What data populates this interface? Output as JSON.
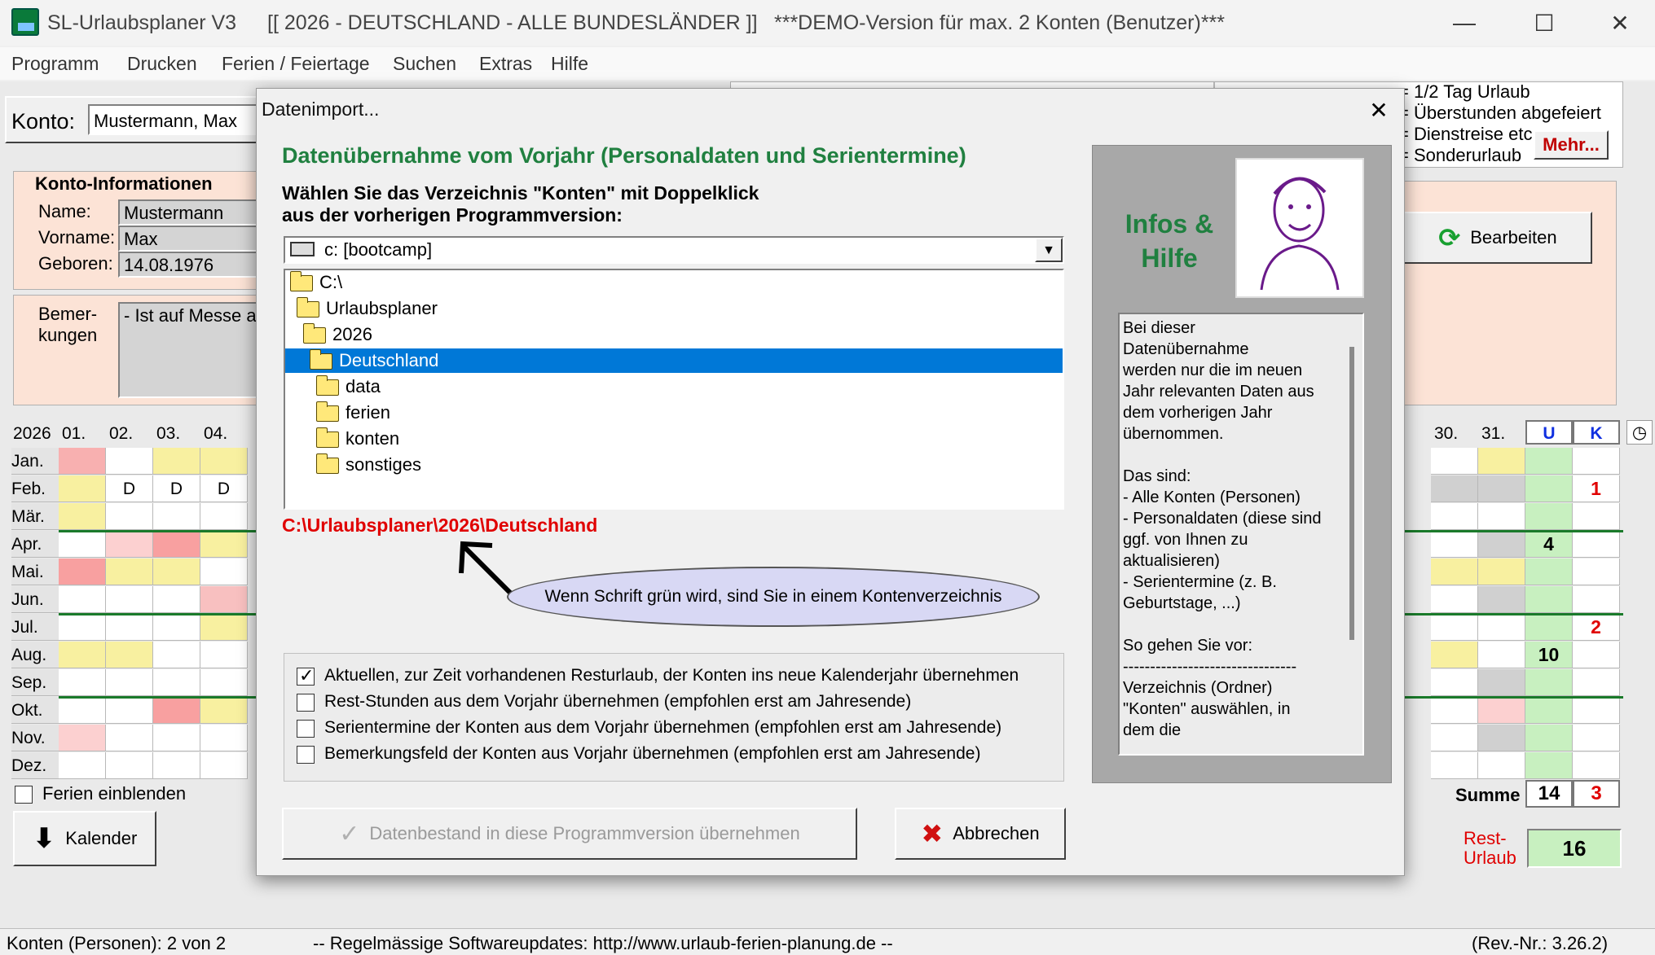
{
  "window": {
    "app_title": "SL-Urlaubsplaner V3",
    "year_title": "[[ 2026 - DEUTSCHLAND - ALLE BUNDESLÄNDER ]]",
    "demo_title": "***DEMO-Version für max. 2 Konten (Benutzer)***",
    "min": "—",
    "max": "☐",
    "close": "✕"
  },
  "menu": [
    "Programm",
    "Drucken",
    "Ferien / Feiertage",
    "Suchen",
    "Extras",
    "Hilfe"
  ],
  "konto": {
    "label": "Konto:",
    "value": "Mustermann, Max"
  },
  "info": {
    "title": "Konto-Informationen",
    "name_label": "Name:",
    "name": "Mustermann",
    "vorname_label": "Vorname:",
    "vorname": "Max",
    "geboren_label": "Geboren:",
    "geboren": "14.08.1976",
    "bemerkungen_label": "Bemer-\nkungen",
    "bemerkungen": "- Ist auf Messe am"
  },
  "legend": {
    "items": [
      "= 1/2 Tag Urlaub",
      "= Überstunden abgefeiert",
      "= Dienstreise etc.",
      "= Sonderurlaub"
    ],
    "more": "Mehr..."
  },
  "edit_button": "Bearbeiten",
  "calendar": {
    "year": "2026",
    "days_left": [
      "01.",
      "02.",
      "03.",
      "04."
    ],
    "days_right": [
      "30.",
      "31."
    ],
    "u_header": "U",
    "k_header": "K",
    "months": [
      "Jan.",
      "Feb.",
      "Mär.",
      "Apr.",
      "Mai.",
      "Jun.",
      "Jul.",
      "Aug.",
      "Sep.",
      "Okt.",
      "Nov.",
      "Dez."
    ],
    "feb_marks": [
      "D",
      "D",
      "D"
    ],
    "u_values": [
      "",
      "",
      "",
      "4",
      "",
      "",
      "",
      "10",
      "",
      "",
      "",
      ""
    ],
    "k_values": [
      "",
      "1",
      "",
      "",
      "",
      "",
      "2",
      "",
      "",
      "",
      "",
      ""
    ],
    "summe_label": "Summe",
    "summe_u": "14",
    "summe_k": "3",
    "rest_label": "Rest-\nUrlaub",
    "rest_value": "16",
    "ferien_label": "Ferien einblenden",
    "kalender_button": "Kalender"
  },
  "dialog": {
    "title": "Datenimport...",
    "close": "✕",
    "heading": "Datenübernahme vom Vorjahr (Personaldaten und Serientermine)",
    "instruction1": "Wählen Sie das Verzeichnis \"Konten\" mit Doppelklick",
    "instruction2": "aus der vorherigen Programmversion:",
    "drive": "c: [bootcamp]",
    "tree": [
      "C:\\",
      "Urlaubsplaner",
      "2026",
      "Deutschland",
      "data",
      "ferien",
      "konten",
      "sonstiges"
    ],
    "selected_path": "C:\\Urlaubsplaner\\2026\\Deutschland",
    "hint": "Wenn Schrift grün wird, sind Sie in einem Kontenverzeichnis",
    "options": [
      {
        "label": "Aktuellen, zur Zeit vorhandenen Resturlaub, der Konten ins neue Kalenderjahr übernehmen",
        "checked": true
      },
      {
        "label": "Rest-Stunden aus dem Vorjahr übernehmen (empfohlen erst am Jahresende)",
        "checked": false
      },
      {
        "label": "Serientermine der Konten aus dem Vorjahr übernehmen (empfohlen erst am Jahresende)",
        "checked": false
      },
      {
        "label": "Bemerkungsfeld der Konten aus Vorjahr übernehmen (empfohlen erst am Jahresende)",
        "checked": false
      }
    ],
    "import_button": "Datenbestand in diese Programmversion übernehmen",
    "cancel_button": "Abbrechen",
    "info_title": "Infos &\nHilfe",
    "help_text": "Bei dieser\nDatenübernahme\nwerden nur die im neuen\nJahr relevanten Daten aus\ndem vorherigen Jahr\nübernommen.\n\nDas sind:\n- Alle Konten (Personen)\n- Personaldaten (diese sind\nggf. von Ihnen zu\naktualisieren)\n- Serientermine (z. B.\nGeburtstage, ...)\n\nSo gehen Sie vor:\n--------------------------------\nVerzeichnis (Ordner)\n\"Konten\" auswählen, in\ndem die"
  },
  "status": {
    "count": "Konten (Personen): 2 von 2",
    "updates": "-- Regelmässige Softwareupdates:   http://www.urlaub-ferien-planung.de --",
    "rev": "(Rev.-Nr.: 3.26.2)"
  },
  "colors": {
    "green": "#208040",
    "red": "#e00000",
    "select": "#0078d7",
    "pink": "#fce3d6",
    "yellow": "#f8f0a0",
    "lightgreen": "#c8f0c0"
  }
}
